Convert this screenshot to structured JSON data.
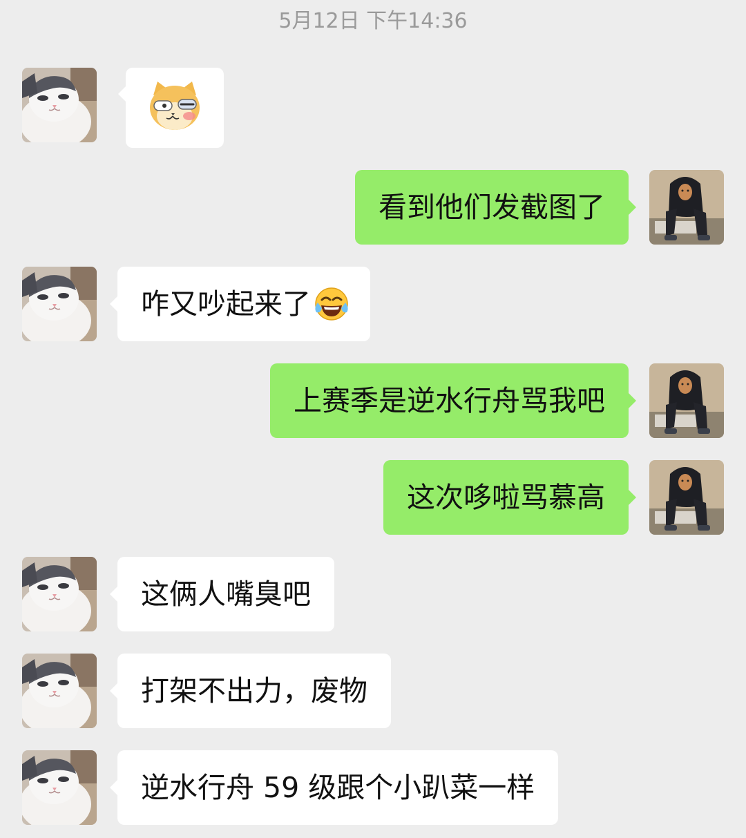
{
  "timestamp": "5月12日 下午14:36",
  "messages": [
    {
      "side": "left",
      "kind": "sticker",
      "sticker_icon": "shiba-sticker-icon"
    },
    {
      "side": "right",
      "text": "看到他们发截图了"
    },
    {
      "side": "left",
      "text": "咋又吵起来了",
      "emoji": "laughing-tears-emoji-icon"
    },
    {
      "side": "right",
      "text": "上赛季是逆水行舟骂我吧"
    },
    {
      "side": "right",
      "text": "这次哆啦骂慕高"
    },
    {
      "side": "left",
      "text": "这俩人嘴臭吧"
    },
    {
      "side": "left",
      "text": "打架不出力，废物"
    },
    {
      "side": "left",
      "text": "逆水行舟 59 级跟个小趴菜一样"
    }
  ],
  "colors": {
    "background": "#EDEDED",
    "incoming_bubble": "#FFFFFF",
    "outgoing_bubble": "#95EC69",
    "timestamp_text": "#9A9A9A"
  }
}
